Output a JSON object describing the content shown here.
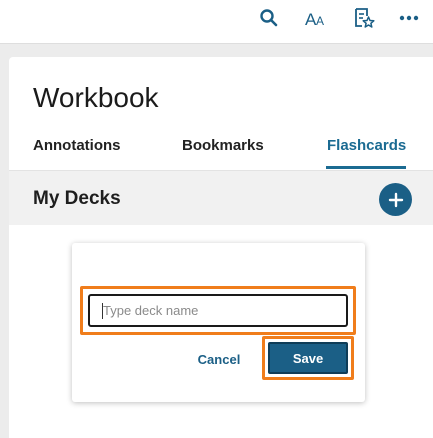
{
  "toolbar": {
    "icons": [
      "search-icon",
      "text-size-icon",
      "bookmark-list-icon",
      "more-icon"
    ],
    "accent": "#1b5f86"
  },
  "panel": {
    "title": "Workbook",
    "tabs": [
      {
        "label": "Annotations",
        "active": false
      },
      {
        "label": "Bookmarks",
        "active": false
      },
      {
        "label": "Flashcards",
        "active": true
      }
    ],
    "section_title": "My Decks",
    "add_icon": "plus-circle-icon"
  },
  "dialog": {
    "input_value": "",
    "input_placeholder": "Type deck name",
    "cancel_label": "Cancel",
    "save_label": "Save",
    "highlight_color": "#f07d1b"
  }
}
